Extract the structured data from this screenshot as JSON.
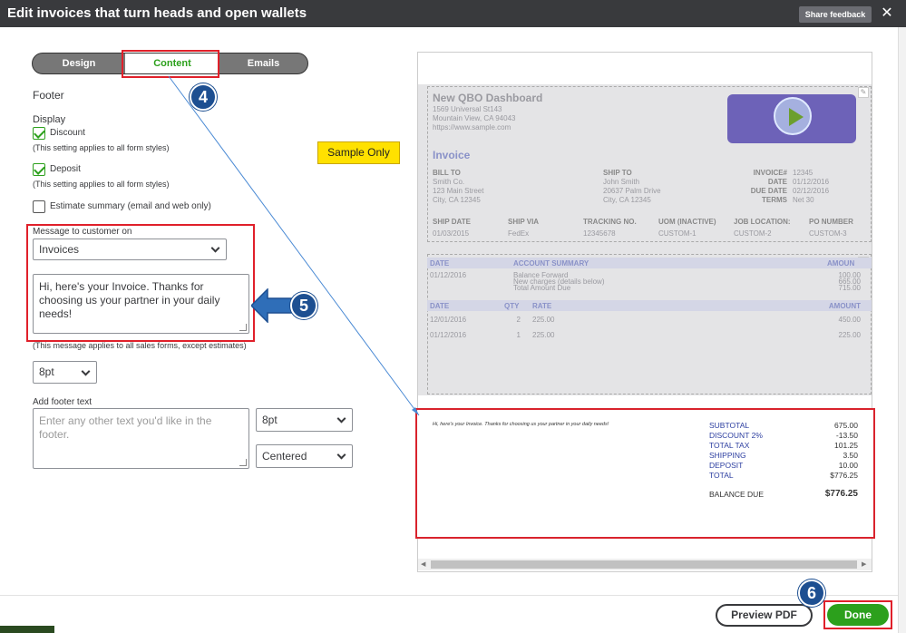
{
  "window": {
    "title": "Edit invoices that turn heads and open wallets",
    "share_feedback": "Share feedback",
    "close_glyph": "✕"
  },
  "tabs": [
    {
      "label": "Design",
      "active": false
    },
    {
      "label": "Content",
      "active": true
    },
    {
      "label": "Emails",
      "active": false
    }
  ],
  "badges": {
    "b4": "4",
    "b5": "5",
    "b6": "6"
  },
  "form": {
    "section_title": "Footer",
    "display_label": "Display",
    "discount": {
      "label": "Discount",
      "checked": true,
      "note": "(This setting applies to all form styles)"
    },
    "deposit": {
      "label": "Deposit",
      "checked": true,
      "note": "(This setting applies to all form styles)"
    },
    "estimate_summary": {
      "label": "Estimate summary (email and web only)",
      "checked": false
    },
    "message_label": "Message to customer on",
    "message_type": "Invoices",
    "message_text": "Hi, here's your Invoice. Thanks for choosing us your partner in your daily needs!",
    "message_note": "(This message applies to all sales forms, except estimates)",
    "message_font_size": "8pt",
    "footer_label": "Add footer text",
    "footer_placeholder": "Enter any other text you'd like in the footer.",
    "footer_font_size": "8pt",
    "footer_alignment": "Centered"
  },
  "sample_label": "Sample Only",
  "preview": {
    "company": "New QBO Dashboard",
    "address": [
      "1569 Universal St143",
      "Mountain View, CA 94043",
      "https://www.sample.com"
    ],
    "invoice_title": "Invoice",
    "bill_to_label": "BILL TO",
    "bill_to": [
      "Smith Co.",
      "123 Main Street",
      "City, CA 12345"
    ],
    "ship_to_label": "SHIP TO",
    "ship_to": [
      "John Smith",
      "20637 Palm Drive",
      "City, CA 12345"
    ],
    "meta": [
      {
        "label": "INVOICE#",
        "value": "12345"
      },
      {
        "label": "DATE",
        "value": "01/12/2016"
      },
      {
        "label": "DUE DATE",
        "value": "02/12/2016"
      },
      {
        "label": "TERMS",
        "value": "Net 30"
      }
    ],
    "ship_headers": [
      "SHIP DATE",
      "SHIP VIA",
      "TRACKING NO.",
      "UOM (INACTIVE)",
      "JOB LOCATION:",
      "PO NUMBER"
    ],
    "ship_values": [
      "01/03/2015",
      "FedEx",
      "12345678",
      "CUSTOM-1",
      "CUSTOM-2",
      "CUSTOM-3"
    ],
    "acct_headers": [
      "DATE",
      "ACCOUNT SUMMARY",
      "AMOUN"
    ],
    "acct_date": "01/12/2016",
    "acct_lines": [
      "Balance Forward",
      "New charges (details below)",
      "Total Amount Due"
    ],
    "acct_values": [
      "100.00",
      "665.00",
      "715.00"
    ],
    "item_headers": [
      "DATE",
      "QTY",
      "RATE",
      "AMOUNT"
    ],
    "items": [
      {
        "date": "12/01/2016",
        "qty": "2",
        "rate": "225.00",
        "amount": "450.00"
      },
      {
        "date": "01/12/2016",
        "qty": "1",
        "rate": "225.00",
        "amount": "225.00"
      }
    ],
    "footer_message": "Hi, here's your Invoice. Thanks for choosing us your partner in your daily needs!",
    "totals": [
      {
        "label": "SUBTOTAL",
        "value": "675.00"
      },
      {
        "label": "DISCOUNT 2%",
        "value": "-13.50"
      },
      {
        "label": "TOTAL TAX",
        "value": "101.25"
      },
      {
        "label": "SHIPPING",
        "value": "3.50"
      },
      {
        "label": "DEPOSIT",
        "value": "10.00"
      },
      {
        "label": "TOTAL",
        "value": "$776.25"
      }
    ],
    "balance_due_label": "BALANCE DUE",
    "balance_due_value": "$776.25"
  },
  "buttons": {
    "preview_pdf": "Preview PDF",
    "done": "Done"
  },
  "colors": {
    "accent": "#2ca01c",
    "highlight": "#e0202a",
    "badge": "#1d4f91",
    "titlebar": "#393a3d"
  }
}
